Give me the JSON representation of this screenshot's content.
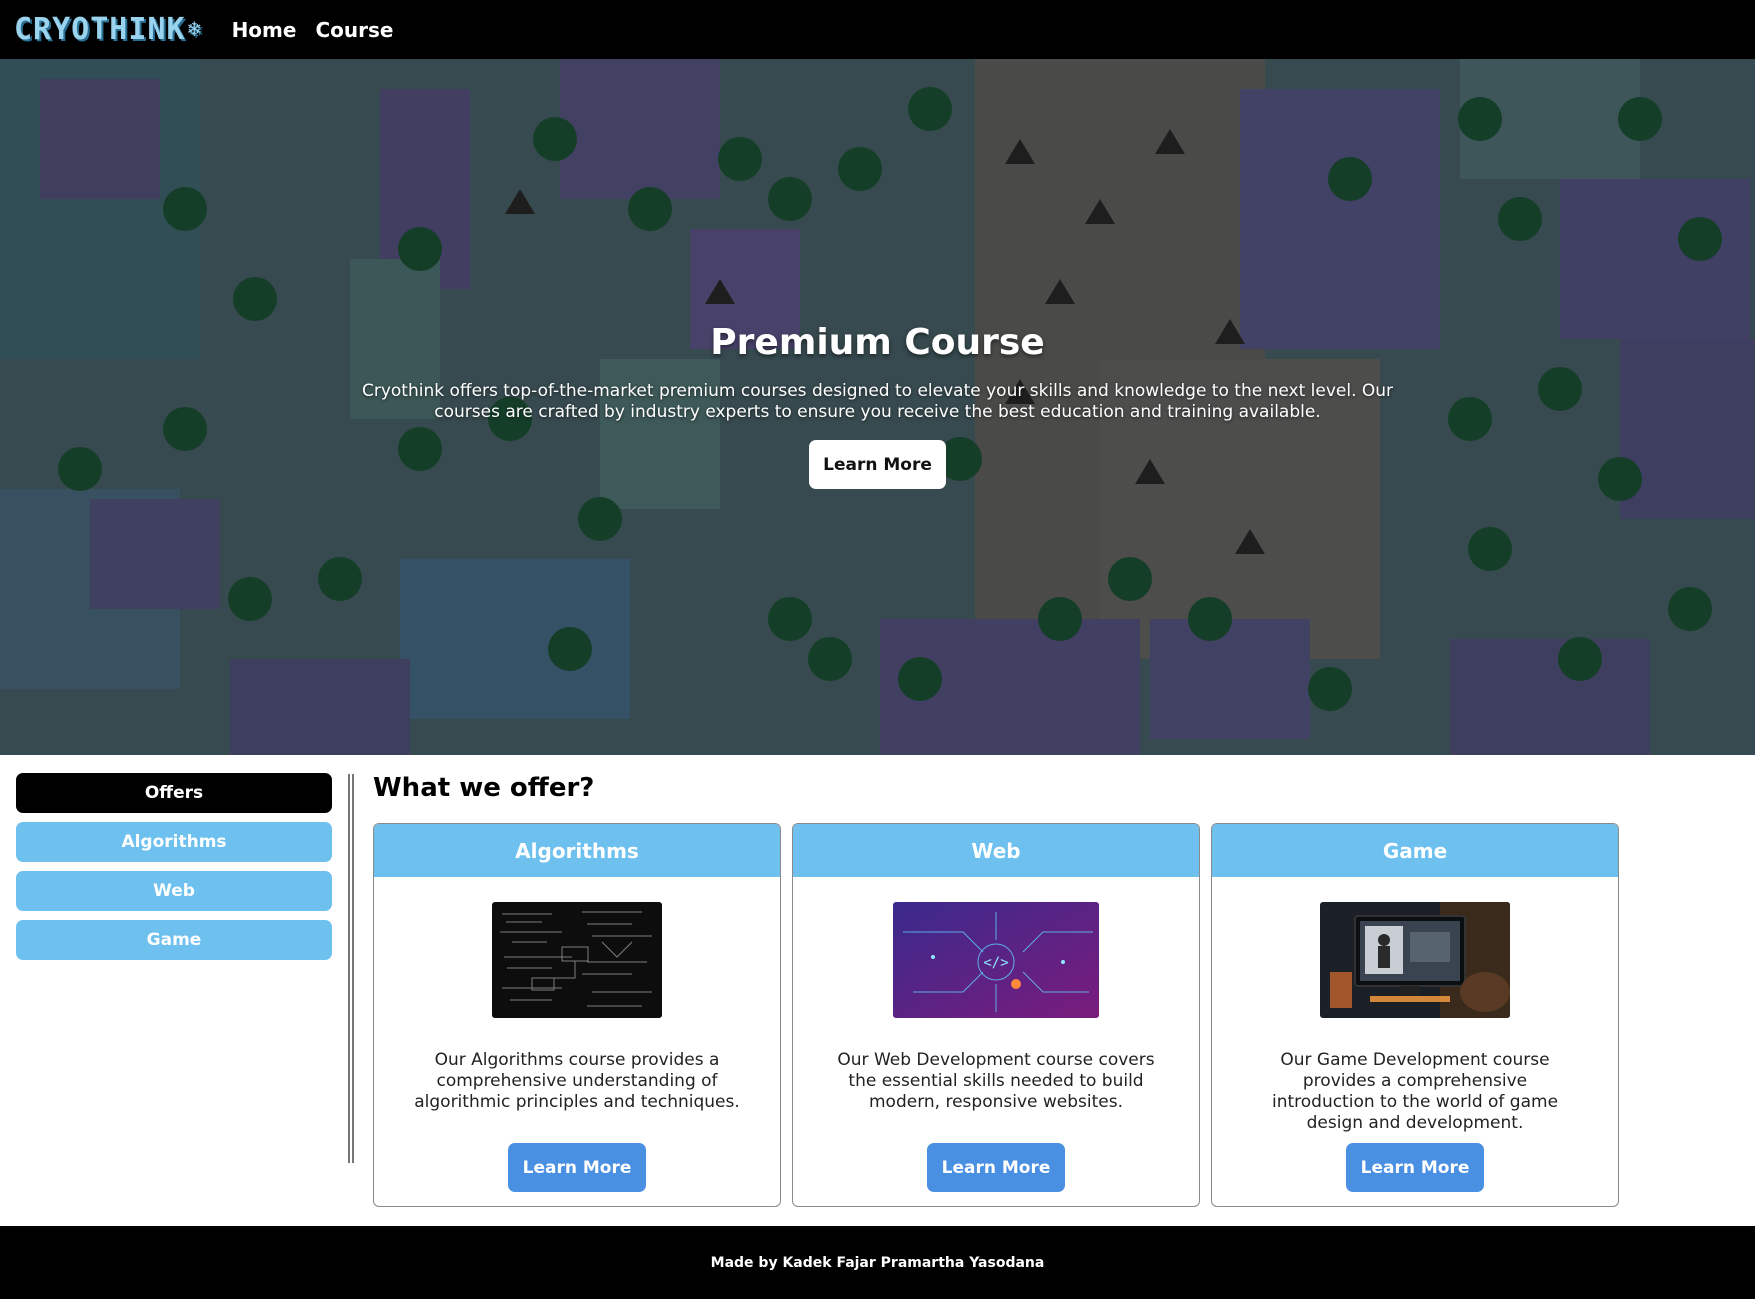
{
  "navbar": {
    "logo_text": "CRYOTHINK",
    "logo_icon": "snowflake-icon",
    "links": [
      {
        "label": "Home"
      },
      {
        "label": "Course"
      }
    ]
  },
  "hero": {
    "title": "Premium Course",
    "description": "Cryothink offers top-of-the-market premium courses designed to elevate your skills and knowledge to the next level. Our courses are crafted by industry experts to ensure you receive the best education and training available.",
    "button_label": "Learn More"
  },
  "sidebar": {
    "items": [
      {
        "label": "Offers",
        "active": true
      },
      {
        "label": "Algorithms",
        "active": false
      },
      {
        "label": "Web",
        "active": false
      },
      {
        "label": "Game",
        "active": false
      }
    ]
  },
  "offers": {
    "title": "What we offer?",
    "cards": [
      {
        "title": "Algorithms",
        "image": "algorithms-image",
        "text": "Our Algorithms course provides a comprehensive understanding of algorithmic principles and techniques.",
        "button": "Learn More"
      },
      {
        "title": "Web",
        "image": "web-image",
        "text": "Our Web Development course covers the essential skills needed to build modern, responsive websites.",
        "button": "Learn More"
      },
      {
        "title": "Game",
        "image": "game-image",
        "text": "Our Game Development course provides a comprehensive introduction to the world of game design and development.",
        "button": "Learn More"
      }
    ]
  },
  "footer": {
    "text": "Made by Kadek Fajar Pramartha Yasodana"
  },
  "colors": {
    "accent": "#6ec0ef",
    "button_blue": "#4a90e2",
    "navbar": "#000000"
  }
}
